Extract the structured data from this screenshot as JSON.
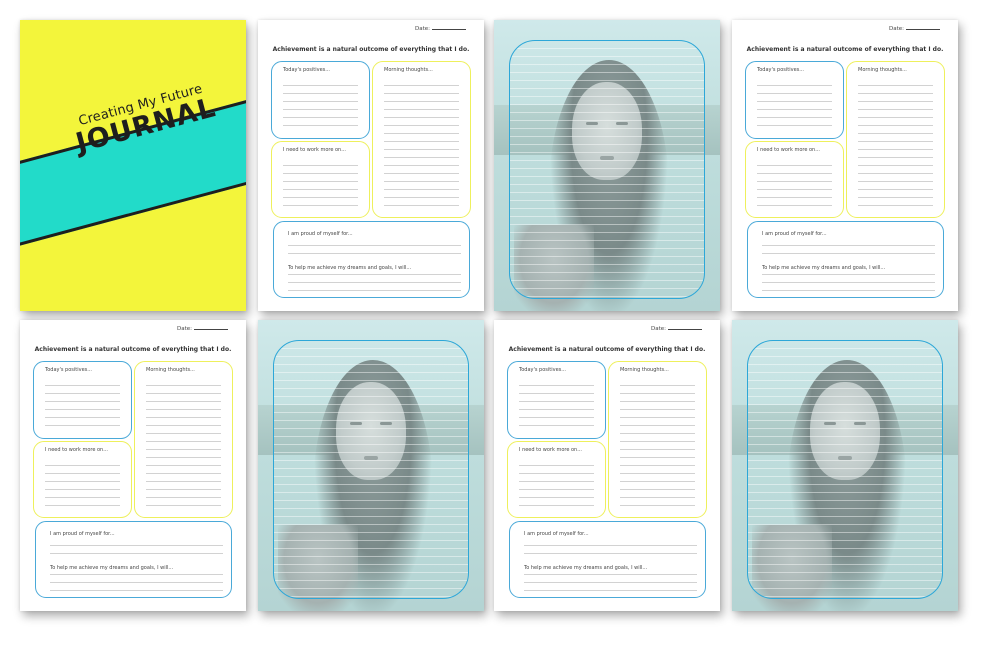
{
  "cover": {
    "subtitle": "Creating My Future",
    "title": "JOURNAL",
    "colors": {
      "background": "#f3f53b",
      "band": "#22dbc9",
      "text": "#1e1e1e"
    }
  },
  "journal": {
    "date_label": "Date:",
    "heading": "Achievement is a natural outcome of everything that I do.",
    "positives_label": "Today's positives...",
    "morning_label": "Morning thoughts...",
    "work_label": "I need to work more on...",
    "proud_label": "I am proud of myself for...",
    "goals_label": "To help me achieve my dreams and goals, I will...",
    "colors": {
      "blue_border": "#4aa9d8",
      "yellow_border": "#eef05c"
    }
  },
  "photo_page": {
    "colors": {
      "frame": "#2da7d8",
      "tint": "#cfe9ea"
    }
  }
}
